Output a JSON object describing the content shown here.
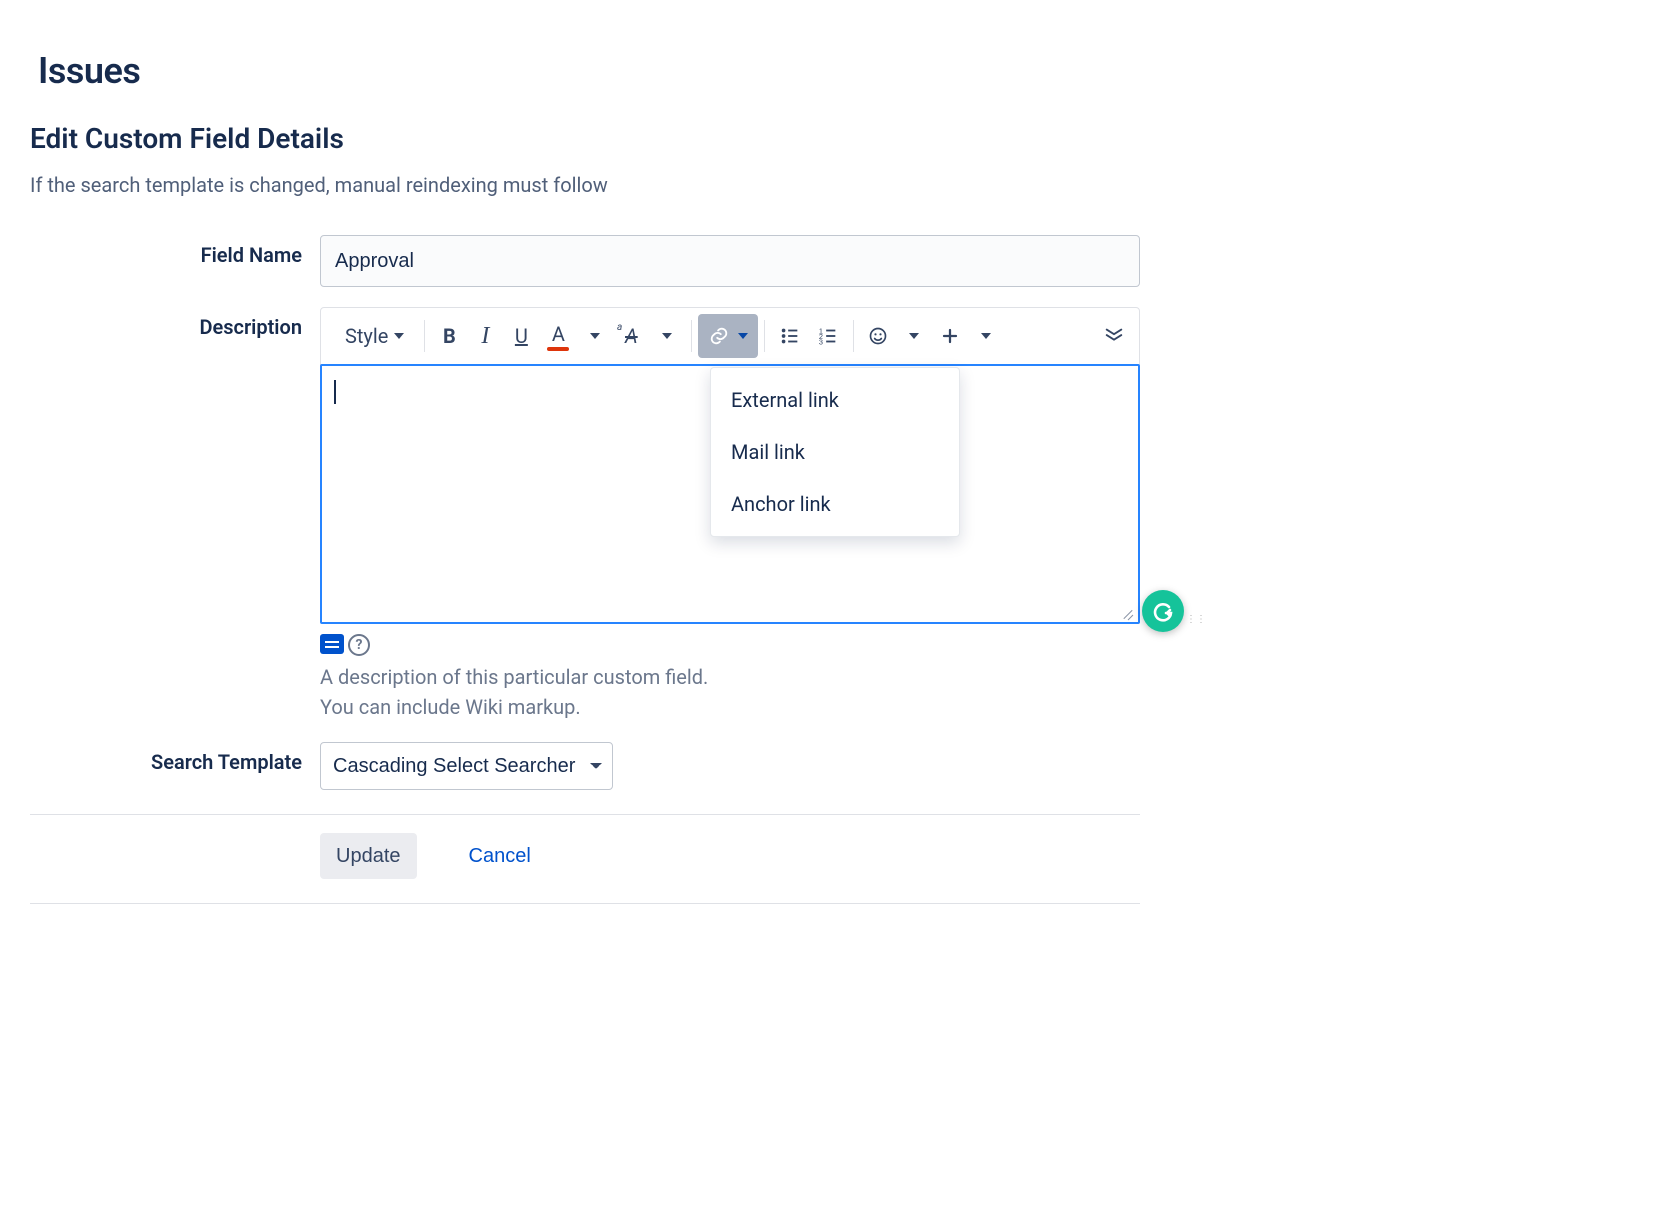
{
  "page": {
    "title": "Issues",
    "section": "Edit Custom Field Details",
    "note": "If the search template is changed, manual reindexing must follow"
  },
  "form": {
    "field_name_label": "Field Name",
    "field_name_value": "Approval",
    "description_label": "Description",
    "description_value": "",
    "description_helper_line1": "A description of this particular custom field.",
    "description_helper_line2": "You can include Wiki markup.",
    "search_template_label": "Search Template",
    "search_template_value": "Cascading Select Searcher"
  },
  "toolbar": {
    "style_label": "Style",
    "buttons": {
      "bold": "B",
      "italic": "I",
      "underline": "U",
      "textcolor": "A",
      "clear_format": "A"
    }
  },
  "link_dropdown": {
    "items": [
      "External link",
      "Mail link",
      "Anchor link"
    ]
  },
  "actions": {
    "submit": "Update",
    "cancel": "Cancel"
  },
  "grammarly": {
    "glyph": "G"
  }
}
